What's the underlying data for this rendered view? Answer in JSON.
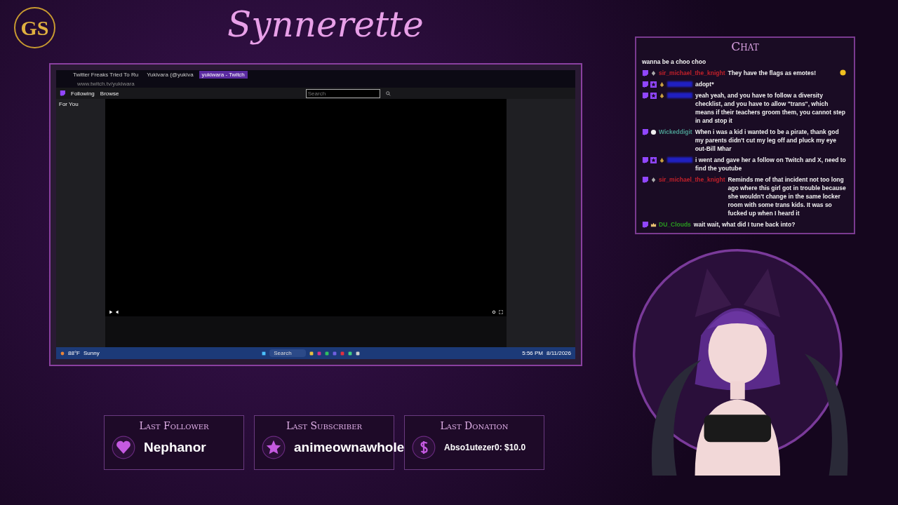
{
  "logo": {
    "text": "GS"
  },
  "title": "Synnerette",
  "capture": {
    "tabs": [
      {
        "label": "Twitter Freaks Tried To Ru",
        "selected": false
      },
      {
        "label": "Yukivara (@yukiva",
        "selected": false
      },
      {
        "label": "yukiwara - Twitch",
        "selected": true
      }
    ],
    "url": "www.twitch.tv/yukiwara",
    "nav": [
      "Following",
      "Browse"
    ],
    "search": {
      "placeholder": "Search"
    },
    "sidebar_title": "For You",
    "taskbar": {
      "weather_temp": "88°F",
      "weather_text": "Sunny",
      "search": "Search",
      "time": "5:56 PM",
      "date": "8/11/2026"
    }
  },
  "chat": {
    "title": "Chat",
    "messages": [
      {
        "kind": "continuation",
        "text": "wanna be a choo choo"
      },
      {
        "kind": "message",
        "badges": [
          {
            "kind": "platform"
          },
          {
            "kind": "rank"
          }
        ],
        "user": "sir_michael_the_knight",
        "color": "#c0202a",
        "text": "They have the flags as emotes!",
        "emote": true
      },
      {
        "kind": "message",
        "badges": [
          {
            "kind": "platform"
          },
          {
            "kind": "star"
          },
          {
            "kind": "gem"
          }
        ],
        "redacted": true,
        "color": "#2020c0",
        "text": "adopt*"
      },
      {
        "kind": "message",
        "badges": [
          {
            "kind": "platform"
          },
          {
            "kind": "star"
          },
          {
            "kind": "gem"
          }
        ],
        "redacted": true,
        "color": "#2020c0",
        "text": "yeah yeah, and you have to follow a diversity checklist, and you have to allow \"trans\", which means if their teachers groom them, you cannot step in and stop it"
      },
      {
        "kind": "message",
        "badges": [
          {
            "kind": "platform"
          },
          {
            "kind": "skull"
          }
        ],
        "user": "Wickeddigit",
        "color": "#4a9a90",
        "text": "When i was a kid i wanted to be a pirate, thank god my parents didn't cut my leg off and pluck my eye out-Bill Mhar"
      },
      {
        "kind": "message",
        "badges": [
          {
            "kind": "platform"
          },
          {
            "kind": "star"
          },
          {
            "kind": "gem"
          }
        ],
        "redacted": true,
        "color": "#2020c0",
        "text": "i went and gave her a follow on Twitch and X, need to find the youtube"
      },
      {
        "kind": "message",
        "badges": [
          {
            "kind": "platform"
          },
          {
            "kind": "rank"
          }
        ],
        "user": "sir_michael_the_knight",
        "color": "#c0202a",
        "text": "Reminds me of that incident not too long ago where this girl got in trouble because she wouldn't change in the same locker room with some trans kids. It was so fucked up when I heard it"
      },
      {
        "kind": "message",
        "badges": [
          {
            "kind": "platform"
          },
          {
            "kind": "crown"
          }
        ],
        "user": "DU_Clouds",
        "color": "#2a9a20",
        "text": "wait wait, what did I tune back into?"
      }
    ]
  },
  "stats": [
    {
      "label": "Last Follower",
      "kind": "heart",
      "value": "Nephanor"
    },
    {
      "label": "Last Subscriber",
      "kind": "star",
      "value": "animeownawhole"
    },
    {
      "label": "Last Donation",
      "kind": "dollar",
      "value": "Abso1utezer0: $10.0"
    }
  ]
}
